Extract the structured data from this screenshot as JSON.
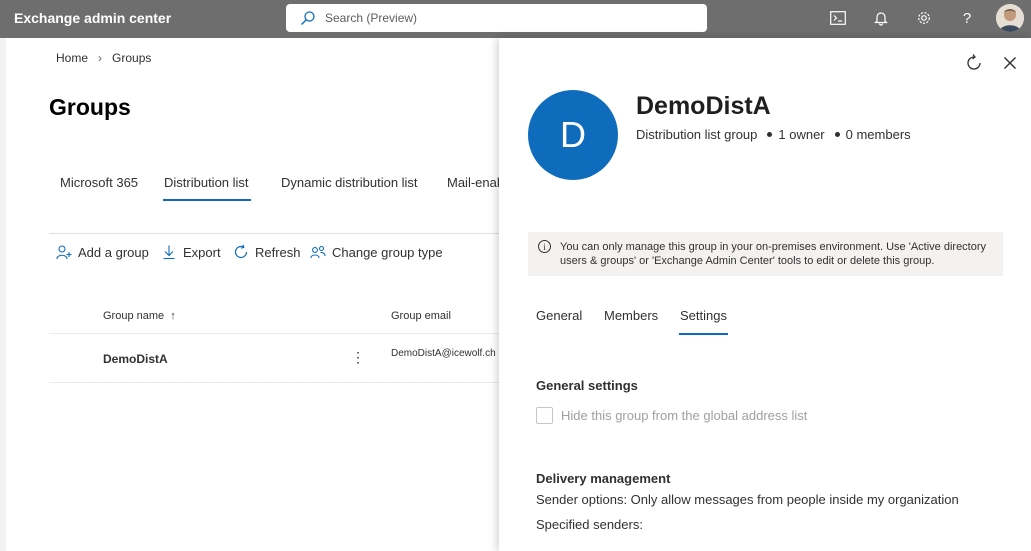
{
  "app": {
    "title": "Exchange admin center"
  },
  "search": {
    "placeholder": "Search (Preview)"
  },
  "topbar_icons": [
    "cloud-shell-icon",
    "bell-icon",
    "gear-icon",
    "help-icon"
  ],
  "help_glyph": "?",
  "breadcrumb": {
    "home": "Home",
    "current": "Groups"
  },
  "page": {
    "title": "Groups"
  },
  "tabs": [
    {
      "label": "Microsoft 365",
      "active": false
    },
    {
      "label": "Distribution list",
      "active": true
    },
    {
      "label": "Dynamic distribution list",
      "active": false
    },
    {
      "label": "Mail-enab",
      "active": false
    }
  ],
  "commands": {
    "add": "Add a group",
    "export": "Export",
    "refresh": "Refresh",
    "change_type": "Change group type"
  },
  "grid": {
    "columns": {
      "name": "Group name",
      "sort_glyph": "↑",
      "email": "Group email"
    },
    "rows": [
      {
        "name": "DemoDistA",
        "more": "⋮",
        "email": "DemoDistA@icewolf.ch"
      }
    ]
  },
  "panel": {
    "avatar_letter": "D",
    "group_name": "DemoDistA",
    "type": "Distribution list group",
    "owners": "1 owner",
    "members": "0 members",
    "info_icon_glyph": "i",
    "info": "You can only manage this group in your on-premises environment. Use 'Active directory users & groups' or 'Exchange Admin Center' tools to edit or delete this group.",
    "tabs": [
      {
        "label": "General",
        "active": false
      },
      {
        "label": "Members",
        "active": false
      },
      {
        "label": "Settings",
        "active": true
      }
    ],
    "general_settings": {
      "heading": "General settings",
      "hide_label": "Hide this group from the global address list",
      "hide_checked": false
    },
    "delivery": {
      "heading": "Delivery management",
      "sender_options": "Sender options: Only allow messages from people inside my organization",
      "specified_senders": "Specified senders:"
    }
  },
  "colors": {
    "accent": "#0f6cbd",
    "topbar": "#6e6e6e"
  }
}
